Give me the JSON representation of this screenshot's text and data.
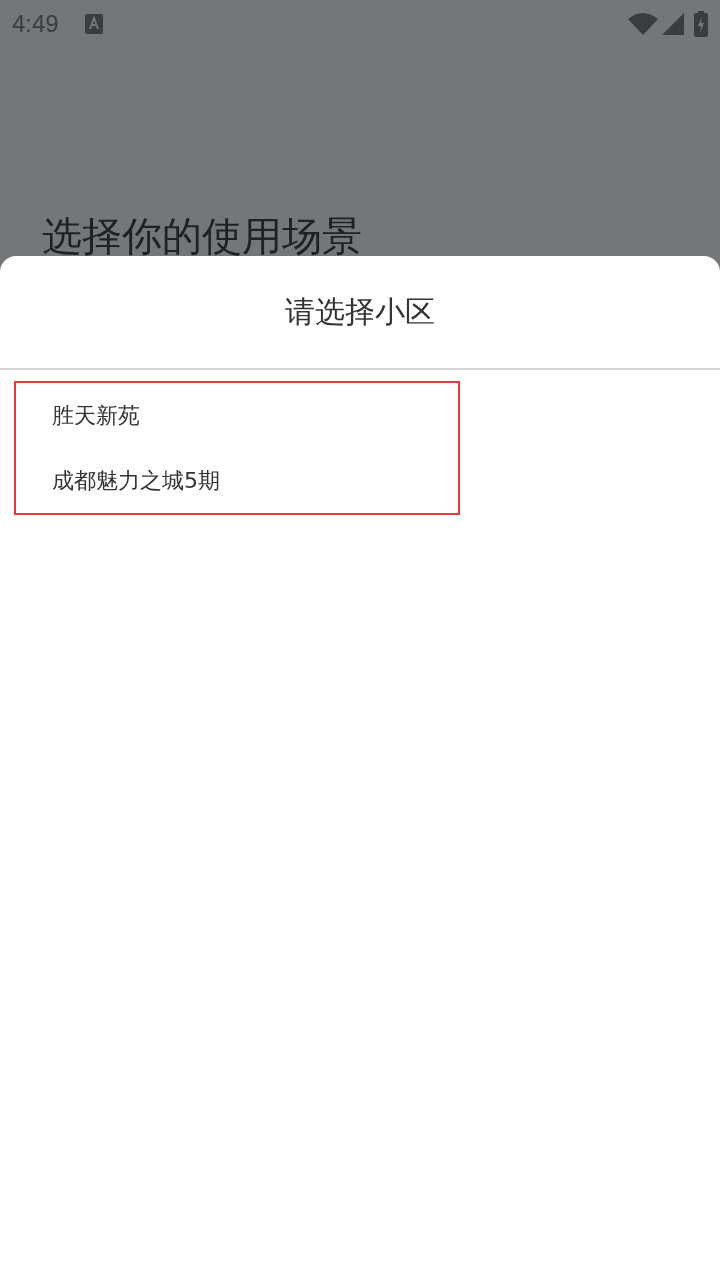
{
  "status_bar": {
    "time": "4:49"
  },
  "page": {
    "title": "选择你的使用场景"
  },
  "sheet": {
    "title": "请选择小区",
    "items": [
      {
        "label": "胜天新苑"
      },
      {
        "label": "成都魅力之城5期"
      }
    ]
  }
}
